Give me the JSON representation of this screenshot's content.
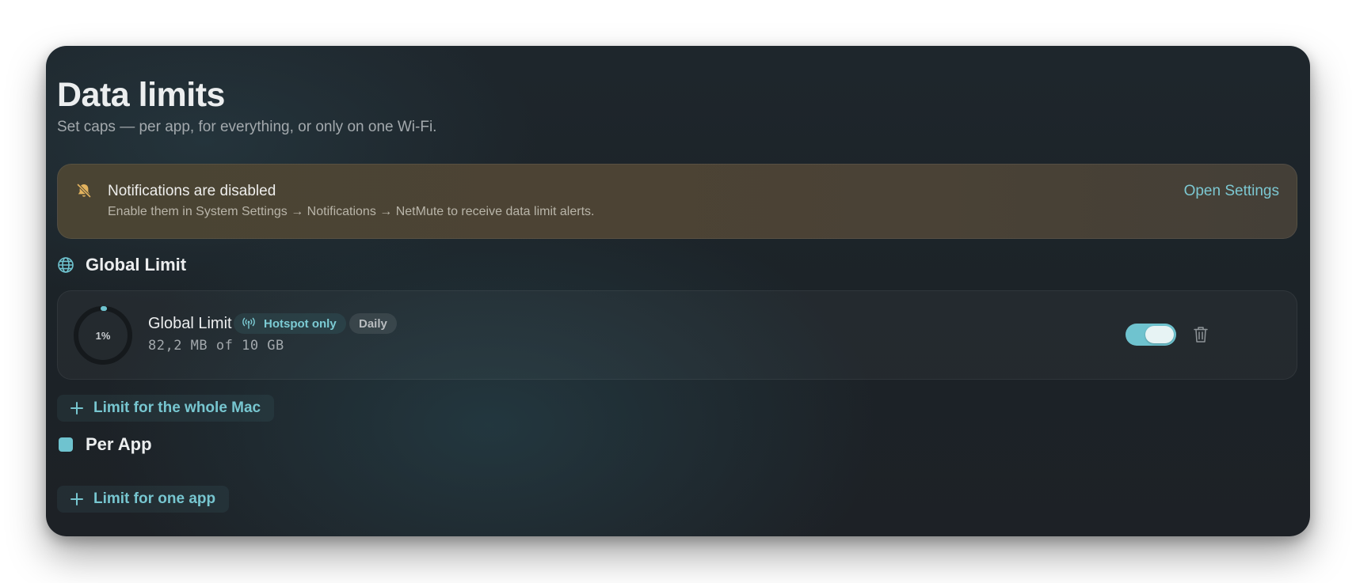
{
  "header": {
    "title": "Data limits",
    "subtitle": "Set caps — per app, for everything, or only on one Wi-Fi."
  },
  "notification_banner": {
    "icon": "bell-slash-icon",
    "title": "Notifications are disabled",
    "description": "Enable them in System Settings → Notifications → NetMute to receive data limit alerts.",
    "action_label": "Open Settings"
  },
  "global_section": {
    "icon": "globe-icon",
    "heading": "Global Limit",
    "limits": [
      {
        "name": "Global Limit",
        "progress_percent": 1,
        "progress_label": "1%",
        "network_badge": "Hotspot only",
        "network_badge_icon": "antenna-icon",
        "period_badge": "Daily",
        "usage_text": "82,2 MB of 10 GB",
        "enabled": true
      }
    ],
    "add_button_label": "Limit for the whole Mac"
  },
  "per_app_section": {
    "icon": "app-square-icon",
    "heading": "Per App",
    "add_button_label": "Limit for one app"
  },
  "colors": {
    "accent": "#6fc3cf",
    "accent_text": "#77c6d0",
    "background": "#1d2328",
    "banner": "#4b4434",
    "warning_icon": "#e3b35e"
  }
}
